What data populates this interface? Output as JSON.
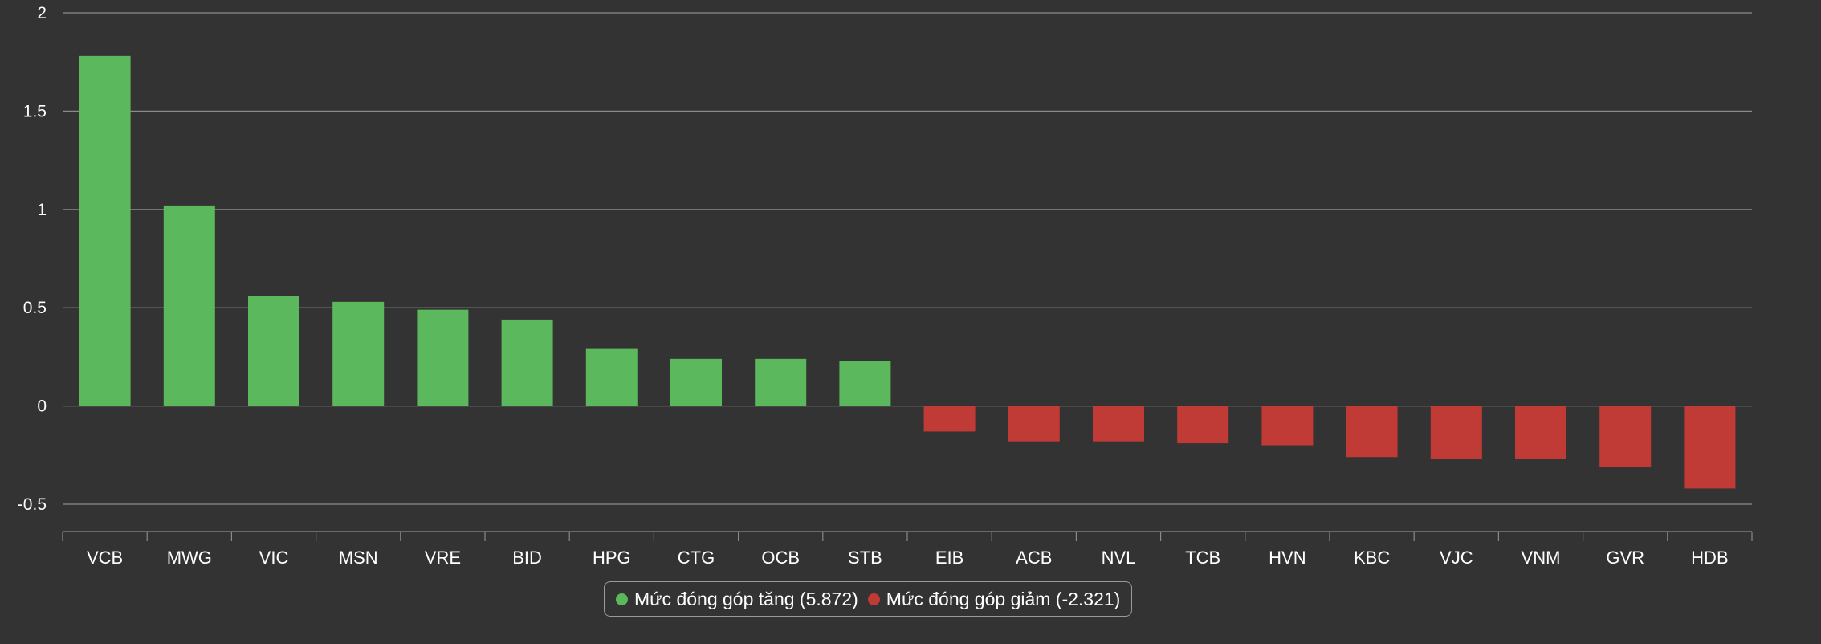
{
  "colors": {
    "positive": "#5cb85c",
    "negative": "#c03a36",
    "background": "#333333",
    "grid": "#8a8a8a",
    "text": "#ffffff"
  },
  "legend": {
    "position": "bottom-center",
    "items": [
      {
        "key": "positive",
        "label": "Mức đóng góp tăng (5.872)"
      },
      {
        "key": "negative",
        "label": "Mức đóng góp giảm (-2.321)"
      }
    ]
  },
  "chart_data": {
    "type": "bar",
    "title": "",
    "xlabel": "",
    "ylabel": "",
    "ylim": [
      -0.5,
      2
    ],
    "yticks": [
      "2",
      "1.5",
      "1",
      "0.5",
      "0",
      "-0.5"
    ],
    "grid": true,
    "categories": [
      "VCB",
      "MWG",
      "VIC",
      "MSN",
      "VRE",
      "BID",
      "HPG",
      "CTG",
      "OCB",
      "STB",
      "EIB",
      "ACB",
      "NVL",
      "TCB",
      "HVN",
      "KBC",
      "VJC",
      "VNM",
      "GVR",
      "HDB"
    ],
    "values": [
      1.78,
      1.02,
      0.56,
      0.53,
      0.49,
      0.44,
      0.29,
      0.24,
      0.24,
      0.23,
      -0.13,
      -0.18,
      -0.18,
      -0.19,
      -0.2,
      -0.26,
      -0.27,
      -0.27,
      -0.31,
      -0.42
    ]
  }
}
